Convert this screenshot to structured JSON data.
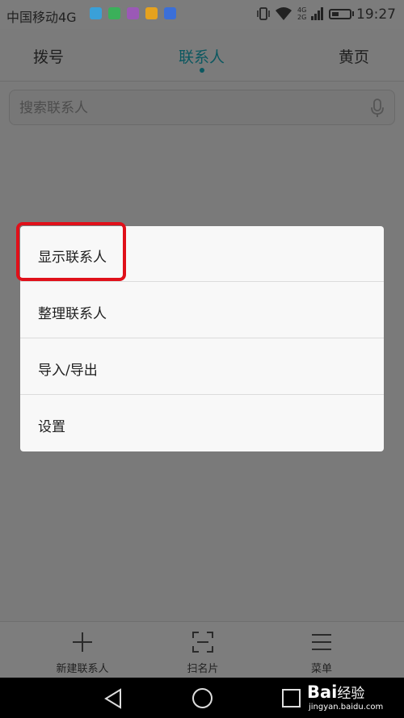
{
  "status_bar": {
    "carrier": "中国移动4G",
    "network_top": "4G",
    "network_bottom": "2G",
    "time": "19:27",
    "app_icon_colors": [
      "#3aa0d8",
      "#3bb05a",
      "#9b59b6",
      "#e6a21e",
      "#3b6fd8"
    ]
  },
  "tabs": [
    {
      "label": "拨号",
      "active": false
    },
    {
      "label": "联系人",
      "active": true
    },
    {
      "label": "黄页",
      "active": false
    }
  ],
  "search": {
    "placeholder": "搜索联系人",
    "icon": "mic-icon"
  },
  "menu": {
    "items": [
      {
        "label": "显示联系人",
        "highlighted": true
      },
      {
        "label": "整理联系人"
      },
      {
        "label": "导入/导出"
      },
      {
        "label": "设置"
      }
    ]
  },
  "bottom_bar": {
    "items": [
      {
        "label": "新建联系人",
        "icon": "plus-icon"
      },
      {
        "label": "扫名片",
        "icon": "scan-icon"
      },
      {
        "label": "菜单",
        "icon": "menu-icon"
      }
    ]
  },
  "nav_bar": {
    "icons": [
      "back-icon",
      "home-icon",
      "recents-icon"
    ]
  },
  "watermark": {
    "brand": "Bai",
    "brand_suffix": "经验",
    "url": "jingyan.baidu.com"
  },
  "colors": {
    "accent": "#0c5860",
    "highlight": "#e0101a"
  }
}
